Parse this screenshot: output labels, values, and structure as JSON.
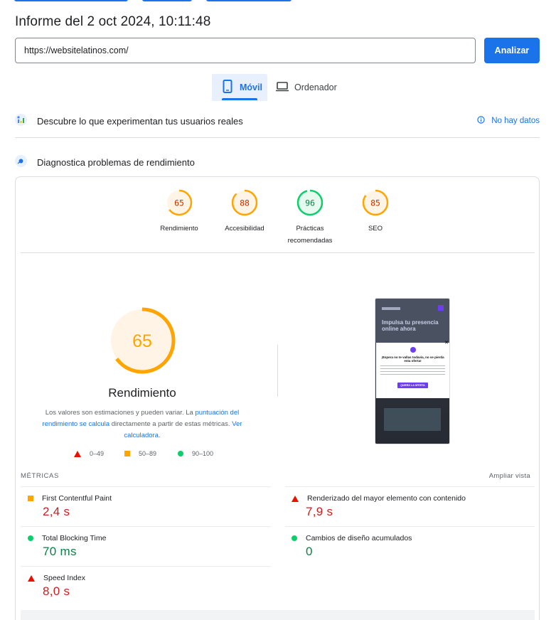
{
  "report": {
    "title": "Informe del 2 oct 2024, 10:11:48"
  },
  "search": {
    "url": "https://websitelatinos.com/",
    "analyze_label": "Analizar"
  },
  "tabs": {
    "mobile": "Móvil",
    "desktop": "Ordenador"
  },
  "crux": {
    "title": "Descubre lo que experimentan tus usuarios reales",
    "no_data": "No hay datos"
  },
  "diagnostics": {
    "title": "Diagnostica problemas de rendimiento"
  },
  "categories": [
    {
      "score": "65",
      "label": "Rendimiento",
      "value": 65,
      "color": "#ffa400"
    },
    {
      "score": "88",
      "label": "Accesibilidad",
      "value": 88,
      "color": "#ffa400"
    },
    {
      "score": "96",
      "label": "Prácticas recomendadas",
      "value": 96,
      "color": "#0cce6b"
    },
    {
      "score": "85",
      "label": "SEO",
      "value": 85,
      "color": "#ffa400"
    }
  ],
  "performance": {
    "score": "65",
    "label": "Rendimiento",
    "note_1": "Los valores son estimaciones y pueden variar. La ",
    "note_link_1": "puntuación del rendimiento se calcula",
    "note_2": " directamente a partir de estas métricas. ",
    "note_link_2": "Ver calculadora",
    "note_3": "."
  },
  "legend": {
    "fail": "0–49",
    "average": "50–89",
    "pass": "90–100"
  },
  "screenshot": {
    "headline": "Impulsa tu presencia online ahora",
    "modal_title": "¡Espera no te vallas todavía, no se pierda esta oferta!",
    "button": "QUIERO LA OFERTA"
  },
  "metrics": {
    "heading": "MÉTRICAS",
    "expand": "Ampliar vista",
    "fcp": {
      "name": "First Contentful Paint",
      "value": "2,4 s"
    },
    "lcp": {
      "name": "Renderizado del mayor elemento con contenido",
      "value": "7,9 s"
    },
    "tbt": {
      "name": "Total Blocking Time",
      "value": "70 ms"
    },
    "cls": {
      "name": "Cambios de diseño acumulados",
      "value": "0"
    },
    "si": {
      "name": "Speed Index",
      "value": "8,0 s"
    }
  },
  "colors": {
    "accent": "#1a73e8",
    "pass": "#0cce6b",
    "average": "#ffa400",
    "fail": "#eb0f00"
  }
}
